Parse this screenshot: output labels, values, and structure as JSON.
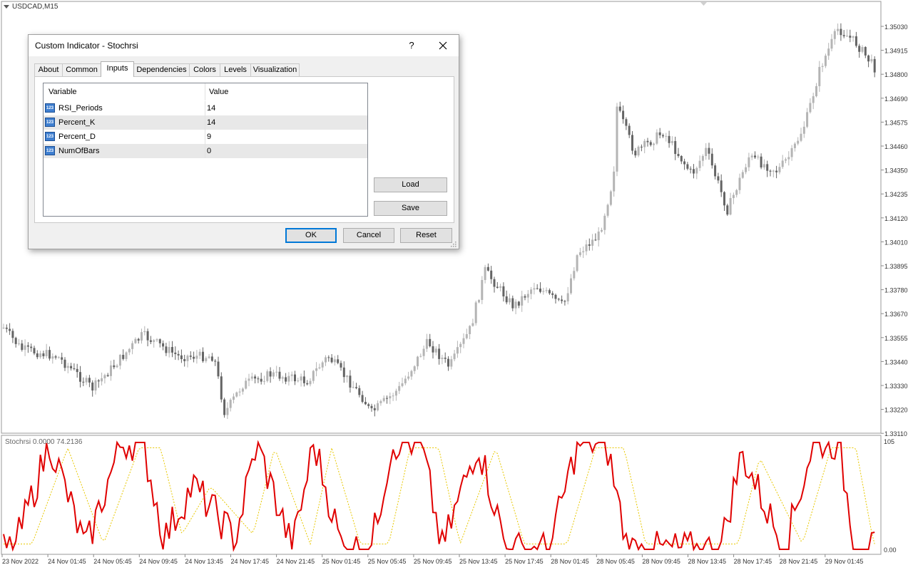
{
  "chart": {
    "symbol_label": "USDCAD,M15",
    "indicator_label": "Stochrsi 0.0000 74.2136",
    "price_axis": [
      "1.35030",
      "1.34915",
      "1.34800",
      "1.34690",
      "1.34575",
      "1.34460",
      "1.34350",
      "1.34235",
      "1.34120",
      "1.34010",
      "1.33895",
      "1.33780",
      "1.33670",
      "1.33555",
      "1.33440",
      "1.33330",
      "1.33220",
      "1.33110"
    ],
    "indicator_axis": [
      "105",
      "0.00"
    ],
    "time_axis": [
      "23 Nov 2022",
      "24 Nov 01:45",
      "24 Nov 05:45",
      "24 Nov 09:45",
      "24 Nov 13:45",
      "24 Nov 17:45",
      "24 Nov 21:45",
      "25 Nov 01:45",
      "25 Nov 05:45",
      "25 Nov 09:45",
      "25 Nov 13:45",
      "25 Nov 17:45",
      "28 Nov 01:45",
      "28 Nov 05:45",
      "28 Nov 09:45",
      "28 Nov 13:45",
      "28 Nov 17:45",
      "28 Nov 21:45",
      "29 Nov 01:45"
    ],
    "colors": {
      "bull": "#b4b4b4",
      "bear": "#646464",
      "k_line": "#e00000",
      "d_line": "#e8c800",
      "grid": "#c8c8c8"
    }
  },
  "dialog": {
    "title": "Custom Indicator - Stochrsi",
    "help": "?",
    "tabs": [
      "About",
      "Common",
      "Inputs",
      "Dependencies",
      "Colors",
      "Levels",
      "Visualization"
    ],
    "active_tab": "Inputs",
    "columns": [
      "Variable",
      "Value"
    ],
    "rows": [
      {
        "icon": "integer-param-icon",
        "name": "RSI_Periods",
        "value": "14"
      },
      {
        "icon": "integer-param-icon",
        "name": "Percent_K",
        "value": "14"
      },
      {
        "icon": "integer-param-icon",
        "name": "Percent_D",
        "value": "9"
      },
      {
        "icon": "integer-param-icon",
        "name": "NumOfBars",
        "value": "0"
      }
    ],
    "icon_text": "123",
    "buttons": {
      "load": "Load",
      "save": "Save",
      "ok": "OK",
      "cancel": "Cancel",
      "reset": "Reset"
    }
  }
}
